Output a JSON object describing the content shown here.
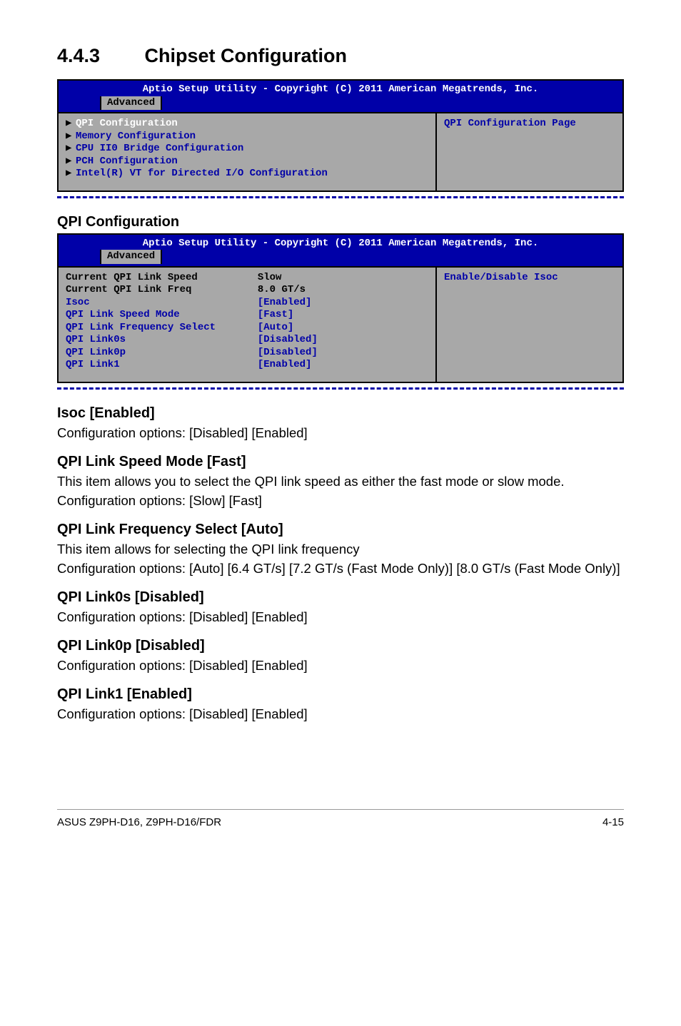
{
  "section": {
    "number": "4.4.3",
    "title": "Chipset Configuration"
  },
  "bios1": {
    "title": "Aptio Setup Utility - Copyright (C) 2011 American Megatrends, Inc.",
    "tab": "Advanced",
    "items": [
      "QPI Configuration",
      "Memory Configuration",
      "CPU II0 Bridge Configuration",
      "PCH Configuration",
      "Intel(R) VT for Directed I/O Configuration"
    ],
    "help": "QPI Configuration Page"
  },
  "qpi_heading": "QPI Configuration",
  "bios2": {
    "title": "Aptio Setup Utility - Copyright (C) 2011 American Megatrends, Inc.",
    "tab": "Advanced",
    "rows": [
      {
        "label": "Current QPI Link Speed",
        "value": "Slow",
        "static": true
      },
      {
        "label": "Current QPI Link Freq",
        "value": "8.0 GT/s",
        "static": true
      },
      {
        "label": "Isoc",
        "value": "[Enabled]",
        "static": false
      },
      {
        "label": "QPI Link Speed Mode",
        "value": "[Fast]",
        "static": false
      },
      {
        "label": "QPI Link Frequency Select",
        "value": "[Auto]",
        "static": false
      },
      {
        "label": "QPI Link0s",
        "value": "[Disabled]",
        "static": false
      },
      {
        "label": "QPI Link0p",
        "value": "[Disabled]",
        "static": false
      },
      {
        "label": "QPI Link1",
        "value": "[Enabled]",
        "static": false
      }
    ],
    "help": "Enable/Disable Isoc"
  },
  "items": [
    {
      "heading": "Isoc [Enabled]",
      "lines": [
        "Configuration options: [Disabled] [Enabled]"
      ]
    },
    {
      "heading": "QPI Link Speed Mode [Fast]",
      "lines": [
        "This item allows you to select the QPI link speed as either the fast mode or slow mode.",
        "Configuration options: [Slow] [Fast]"
      ]
    },
    {
      "heading": "QPI Link Frequency Select [Auto]",
      "lines": [
        "This item allows for selecting the QPI link frequency",
        "Configuration options: [Auto] [6.4 GT/s] [7.2 GT/s (Fast Mode Only)] [8.0 GT/s (Fast Mode Only)]"
      ]
    },
    {
      "heading": "QPI Link0s [Disabled]",
      "lines": [
        "Configuration options: [Disabled] [Enabled]"
      ]
    },
    {
      "heading": "QPI Link0p [Disabled]",
      "lines": [
        "Configuration options: [Disabled] [Enabled]"
      ]
    },
    {
      "heading": "QPI Link1 [Enabled]",
      "lines": [
        "Configuration options: [Disabled] [Enabled]"
      ]
    }
  ],
  "footer": {
    "left": "ASUS Z9PH-D16, Z9PH-D16/FDR",
    "right": "4-15"
  }
}
